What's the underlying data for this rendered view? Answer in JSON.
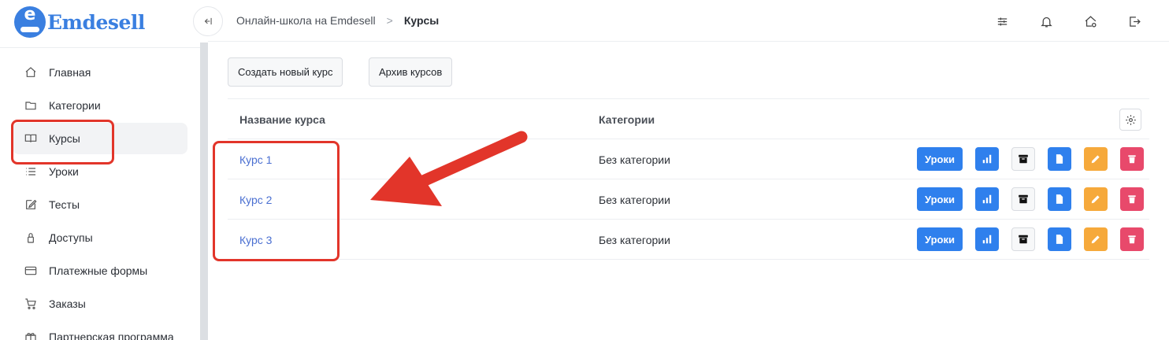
{
  "brand": {
    "logo_letter": "e",
    "name": "Emdesell",
    "color": "#3a7fe0"
  },
  "sidebar": {
    "items": [
      {
        "label": "Главная",
        "icon": "home-icon"
      },
      {
        "label": "Категории",
        "icon": "folder-icon"
      },
      {
        "label": "Курсы",
        "icon": "book-icon",
        "active": true
      },
      {
        "label": "Уроки",
        "icon": "list-icon"
      },
      {
        "label": "Тесты",
        "icon": "edit-icon"
      },
      {
        "label": "Доступы",
        "icon": "lock-icon"
      },
      {
        "label": "Платежные формы",
        "icon": "credit-card-icon"
      },
      {
        "label": "Заказы",
        "icon": "cart-icon"
      },
      {
        "label": "Партнерская программа",
        "icon": "gift-icon"
      }
    ]
  },
  "header": {
    "breadcrumb": [
      "Онлайн-школа на Emdesell",
      "Курсы"
    ],
    "icons": [
      "sliders-icon",
      "bell-icon",
      "home-settings-icon",
      "logout-icon"
    ]
  },
  "toolbar": {
    "create_label": "Создать новый курс",
    "archive_label": "Архив курсов"
  },
  "table": {
    "columns": [
      "Название курса",
      "Категории"
    ],
    "rows": [
      {
        "name": "Курс 1",
        "category": "Без категории"
      },
      {
        "name": "Курс 2",
        "category": "Без категории"
      },
      {
        "name": "Курс 3",
        "category": "Без категории"
      }
    ],
    "action_label": "Уроки"
  },
  "colors": {
    "primary": "#2f80ed",
    "warning": "#f6a93b",
    "danger": "#e8496b",
    "annotation": "#e2352a"
  }
}
